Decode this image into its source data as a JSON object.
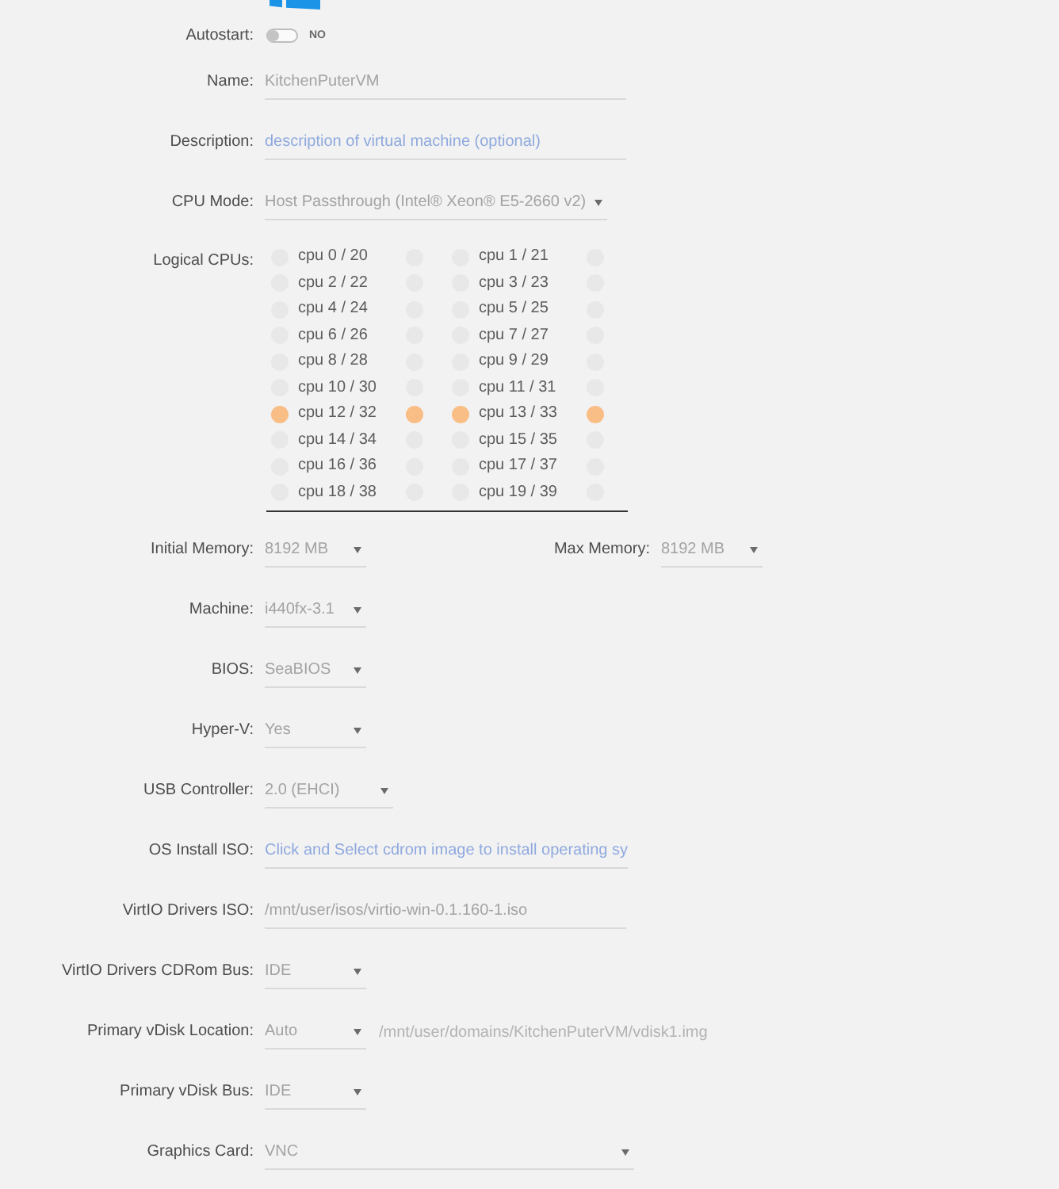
{
  "rows": [
    {
      "kind": "toggle",
      "label": "Autostart:",
      "on": false,
      "state_text": "NO"
    },
    {
      "kind": "text",
      "label": "Name:",
      "value": "KitchenPuterVM"
    },
    {
      "kind": "text",
      "label": "Description:",
      "placeholder": "description of virtual machine (optional)"
    },
    {
      "kind": "select",
      "label": "CPU Mode:",
      "value": "Host Passthrough (Intel® Xeon® E5-2660 v2)"
    },
    {
      "kind": "cpus",
      "label": "Logical CPUs:",
      "cpus": [
        {
          "label": "cpu 0 / 20",
          "threads": [
            {
              "checked": false
            },
            {
              "checked": false
            }
          ]
        },
        {
          "label": "cpu 1 / 21",
          "threads": [
            {
              "checked": false
            },
            {
              "checked": false
            }
          ]
        },
        {
          "label": "cpu 2 / 22",
          "threads": [
            {
              "checked": false
            },
            {
              "checked": false
            }
          ]
        },
        {
          "label": "cpu 3 / 23",
          "threads": [
            {
              "checked": false
            },
            {
              "checked": false
            }
          ]
        },
        {
          "label": "cpu 4 / 24",
          "threads": [
            {
              "checked": false
            },
            {
              "checked": false
            }
          ]
        },
        {
          "label": "cpu 5 / 25",
          "threads": [
            {
              "checked": false
            },
            {
              "checked": false
            }
          ]
        },
        {
          "label": "cpu 6 / 26",
          "threads": [
            {
              "checked": false
            },
            {
              "checked": false
            }
          ]
        },
        {
          "label": "cpu 7 / 27",
          "threads": [
            {
              "checked": false
            },
            {
              "checked": false
            }
          ]
        },
        {
          "label": "cpu 8 / 28",
          "threads": [
            {
              "checked": false
            },
            {
              "checked": false
            }
          ]
        },
        {
          "label": "cpu 9 / 29",
          "threads": [
            {
              "checked": false
            },
            {
              "checked": false
            }
          ]
        },
        {
          "label": "cpu 10 / 30",
          "threads": [
            {
              "checked": false
            },
            {
              "checked": false
            }
          ]
        },
        {
          "label": "cpu 11 / 31",
          "threads": [
            {
              "checked": false
            },
            {
              "checked": false
            }
          ]
        },
        {
          "label": "cpu 12 / 32",
          "threads": [
            {
              "checked": true
            },
            {
              "checked": true
            }
          ]
        },
        {
          "label": "cpu 13 / 33",
          "threads": [
            {
              "checked": true
            },
            {
              "checked": true
            }
          ]
        },
        {
          "label": "cpu 14 / 34",
          "threads": [
            {
              "checked": false
            },
            {
              "checked": false
            }
          ]
        },
        {
          "label": "cpu 15 / 35",
          "threads": [
            {
              "checked": false
            },
            {
              "checked": false
            }
          ]
        },
        {
          "label": "cpu 16 / 36",
          "threads": [
            {
              "checked": false
            },
            {
              "checked": false
            }
          ]
        },
        {
          "label": "cpu 17 / 37",
          "threads": [
            {
              "checked": false
            },
            {
              "checked": false
            }
          ]
        },
        {
          "label": "cpu 18 / 38",
          "threads": [
            {
              "checked": false
            },
            {
              "checked": false
            }
          ]
        },
        {
          "label": "cpu 19 / 39",
          "threads": [
            {
              "checked": false
            },
            {
              "checked": false
            }
          ]
        }
      ]
    },
    {
      "kind": "memory",
      "label": "Initial Memory:",
      "value": "8192 MB",
      "max_label": "Max Memory:",
      "max_value": "8192 MB"
    },
    {
      "kind": "select",
      "label": "Machine:",
      "value": "i440fx-3.1"
    },
    {
      "kind": "select",
      "label": "BIOS:",
      "value": "SeaBIOS"
    },
    {
      "kind": "select",
      "label": "Hyper-V:",
      "value": "Yes"
    },
    {
      "kind": "select",
      "label": "USB Controller:",
      "value": "2.0 (EHCI)"
    },
    {
      "kind": "text",
      "label": "OS Install ISO:",
      "placeholder": "Click and Select cdrom image to install operating sy"
    },
    {
      "kind": "text",
      "label": "VirtIO Drivers ISO:",
      "value": "/mnt/user/isos/virtio-win-0.1.160-1.iso"
    },
    {
      "kind": "select",
      "label": "VirtIO Drivers CDRom Bus:",
      "value": "IDE"
    },
    {
      "kind": "select",
      "label": "Primary vDisk Location:",
      "value": "Auto",
      "path": "/mnt/user/domains/KitchenPuterVM/vdisk1.img"
    },
    {
      "kind": "select",
      "label": "Primary vDisk Bus:",
      "value": "IDE"
    },
    {
      "kind": "select",
      "label": "Graphics Card:",
      "value": "VNC"
    }
  ]
}
